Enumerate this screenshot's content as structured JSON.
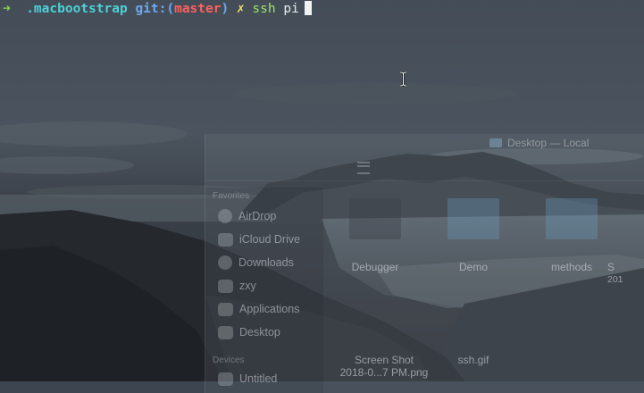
{
  "terminal": {
    "prompt_arrow": "➜",
    "directory": ".macbootstrap",
    "git_prefix": "git:(",
    "branch": "master",
    "git_suffix": ")",
    "dirty_mark": "✗",
    "command": "ssh",
    "argument": "pi",
    "cursor_icon": "block-cursor-icon"
  },
  "finder": {
    "title": "Desktop — Local",
    "sidebar": {
      "favorites_label": "Favorites",
      "devices_label": "Devices",
      "items": [
        {
          "label": "AirDrop",
          "icon": "airdrop-icon"
        },
        {
          "label": "iCloud Drive",
          "icon": "cloud-icon"
        },
        {
          "label": "Downloads",
          "icon": "downloads-icon"
        },
        {
          "label": "zxy",
          "icon": "home-icon"
        },
        {
          "label": "Applications",
          "icon": "applications-icon"
        },
        {
          "label": "Desktop",
          "icon": "desktop-icon"
        }
      ],
      "device_items": [
        {
          "label": "Untitled",
          "icon": "disk-icon"
        }
      ]
    },
    "files": [
      {
        "name": "Debugger",
        "name2": ""
      },
      {
        "name": "Demo",
        "name2": ""
      },
      {
        "name": "methods",
        "name2": ""
      },
      {
        "name": "S",
        "name2": "201"
      },
      {
        "name": "Screen Shot",
        "name2": "2018-0...7 PM.png"
      },
      {
        "name": "ssh.gif",
        "name2": ""
      }
    ]
  },
  "colors": {
    "prompt_green": "#8bd648",
    "dir_cyan": "#4fd0d8",
    "branch_red": "#ff5f5f",
    "dirty_yellow": "#f1e36c"
  }
}
